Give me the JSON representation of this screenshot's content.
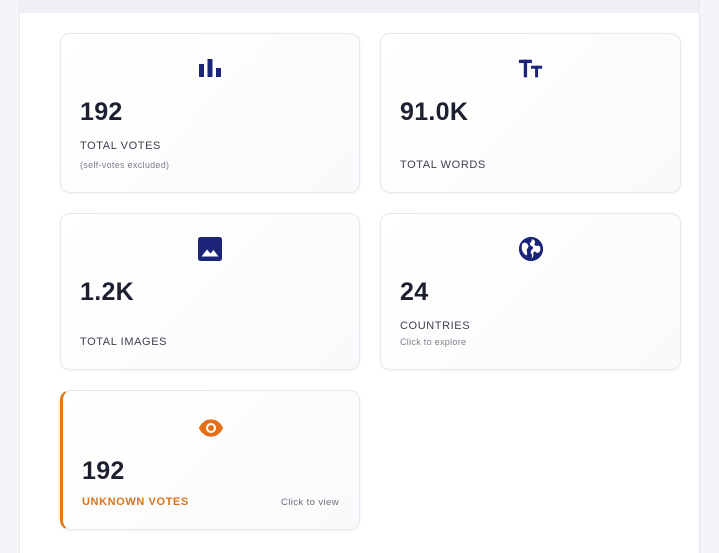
{
  "colors": {
    "icon_primary": "#1b2479",
    "accent_orange": "#e2701b"
  },
  "cards": [
    {
      "icon": "bar-chart-icon",
      "value": "192",
      "label": "TOTAL VOTES",
      "sub": "(self-votes excluded)"
    },
    {
      "icon": "text-size-icon",
      "value": "91.0K",
      "label": "TOTAL WORDS"
    },
    {
      "icon": "image-icon",
      "value": "1.2K",
      "label": "TOTAL IMAGES"
    },
    {
      "icon": "globe-icon",
      "value": "24",
      "label": "COUNTRIES",
      "sub": "Click to explore"
    },
    {
      "icon": "eye-icon",
      "value": "192",
      "label": "UNKNOWN VOTES",
      "hint": "Click to view"
    }
  ]
}
